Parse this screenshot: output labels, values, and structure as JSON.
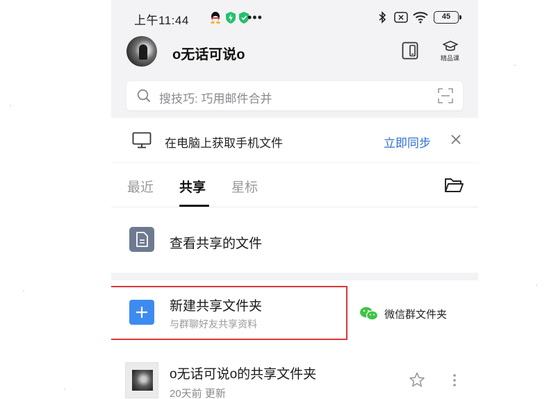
{
  "status_bar": {
    "time": "上午11:44",
    "battery": "45"
  },
  "header": {
    "username": "o无话可说o",
    "course_label": "精品课"
  },
  "search": {
    "placeholder": "搜技巧: 巧用邮件合并"
  },
  "sync_banner": {
    "text": "在电脑上获取手机文件",
    "action": "立即同步"
  },
  "tabs": [
    {
      "label": "最近"
    },
    {
      "label": "共享"
    },
    {
      "label": "星标"
    }
  ],
  "shared_files": {
    "label": "查看共享的文件"
  },
  "new_shared_folder": {
    "title": "新建共享文件夹",
    "subtitle": "与群聊好友共享资料"
  },
  "wechat_folder": {
    "label": "微信群文件夹"
  },
  "folders": [
    {
      "name": "o无话可说o的共享文件夹",
      "updated": "20天前 更新"
    }
  ],
  "colors": {
    "accent": "#2f6fd1",
    "highlight": "#d9373b",
    "plus_button": "#3d8bef",
    "wechat": "#3ec447"
  }
}
